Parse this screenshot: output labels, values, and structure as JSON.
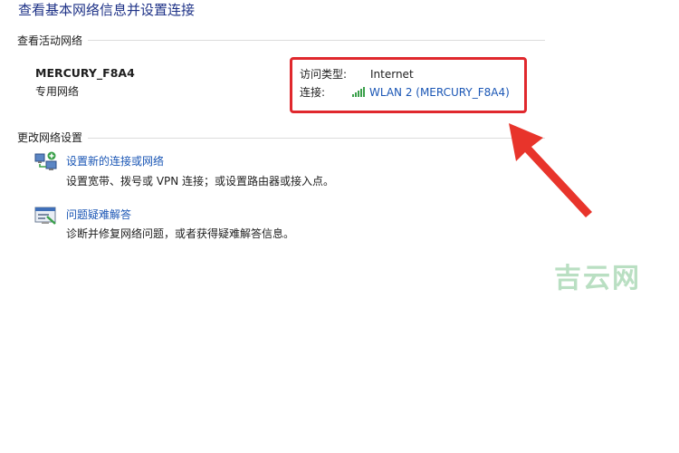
{
  "page": {
    "title": "查看基本网络信息并设置连接"
  },
  "active_networks": {
    "heading": "查看活动网络",
    "network_name": "MERCURY_F8A4",
    "network_category": "专用网络",
    "access_type_label": "访问类型:",
    "access_type_value": "Internet",
    "connections_label": "连接:",
    "connection_link": "WLAN 2 (MERCURY_F8A4)",
    "connection_icon": "wifi-signal-icon"
  },
  "change_settings": {
    "heading": "更改网络设置",
    "tasks": [
      {
        "icon": "new-connection-icon",
        "link": "设置新的连接或网络",
        "description": "设置宽带、拨号或 VPN 连接；或设置路由器或接入点。"
      },
      {
        "icon": "troubleshoot-icon",
        "link": "问题疑难解答",
        "description": "诊断并修复网络问题，或者获得疑难解答信息。"
      }
    ]
  },
  "annotation": {
    "highlight_color": "#e0282d",
    "arrow_icon": "red-arrow-icon"
  },
  "watermark": {
    "text": "吉云网",
    "color": "#b9dfc2"
  }
}
